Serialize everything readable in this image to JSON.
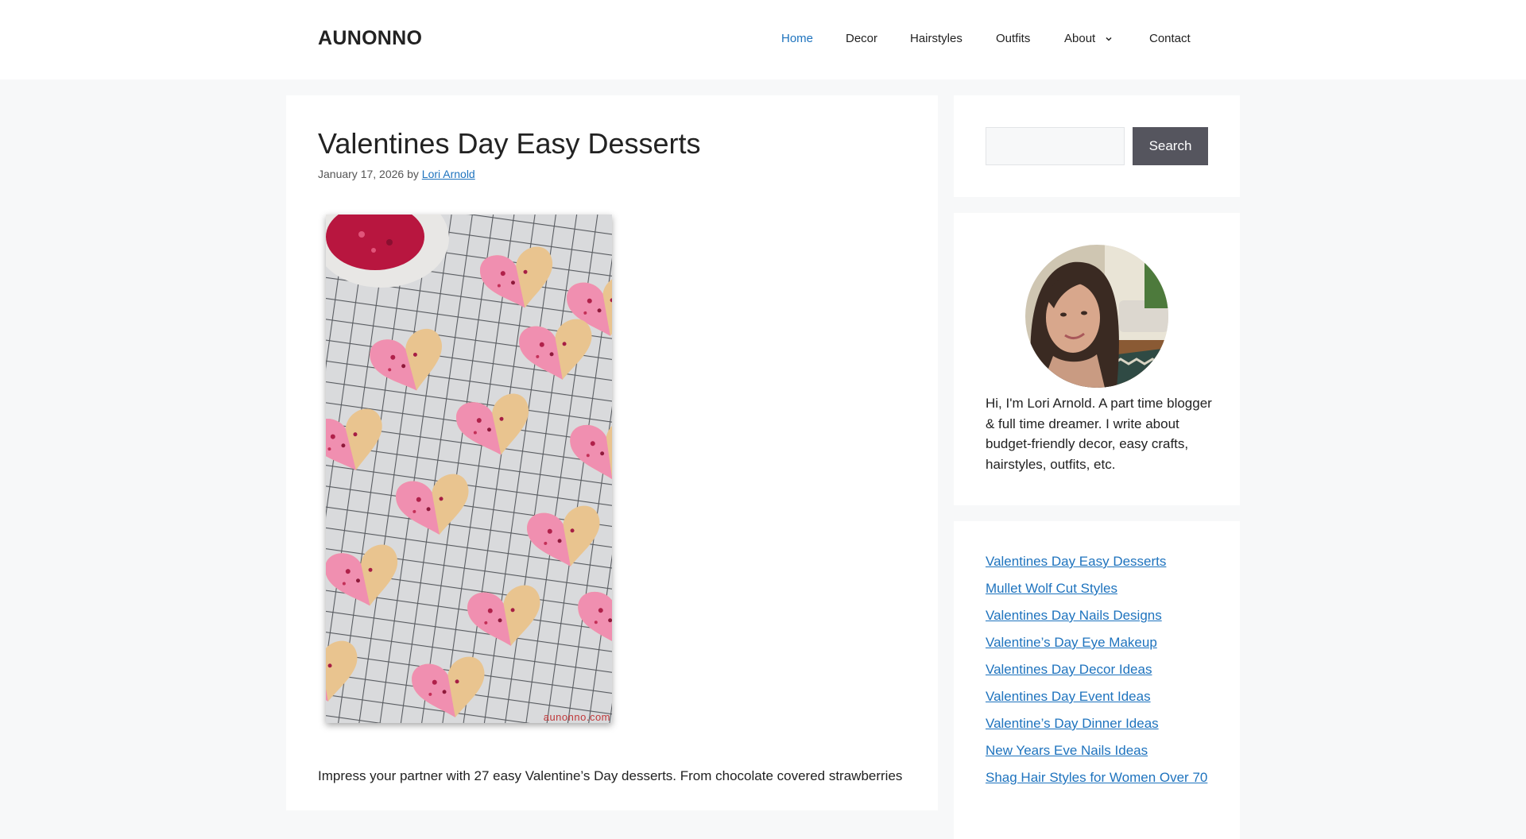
{
  "site": {
    "logo": "AUNONNO"
  },
  "nav": {
    "items": [
      {
        "label": "Home",
        "active": true
      },
      {
        "label": "Decor"
      },
      {
        "label": "Hairstyles"
      },
      {
        "label": "Outfits"
      },
      {
        "label": "About",
        "has_dropdown": true
      },
      {
        "label": "Contact"
      }
    ]
  },
  "post": {
    "title": "Valentines Day Easy Desserts",
    "date": "January 17, 2026",
    "by": "by",
    "author": "Lori Arnold",
    "image_watermark": "aunonno.com",
    "excerpt": "Impress your partner with 27 easy Valentine’s Day desserts. From chocolate covered strawberries"
  },
  "search": {
    "placeholder": "",
    "button_label": "Search"
  },
  "about": {
    "text": "Hi, I'm Lori Arnold. A part time blogger & full time dreamer. I write about budget-friendly decor, easy crafts, hairstyles, outfits, etc."
  },
  "recent_posts": [
    "Valentines Day Easy Desserts",
    "Mullet Wolf Cut Styles",
    "Valentines Day Nails Designs",
    "Valentine’s Day Eye Makeup",
    "Valentines Day Decor Ideas",
    "Valentines Day Event Ideas",
    "Valentine’s Day Dinner Ideas",
    "New Years Eve Nails Ideas",
    "Shag Hair Styles for Women Over 70"
  ],
  "colors": {
    "link": "#1e73be",
    "button": "#55555e",
    "page_bg": "#f7f8f9"
  },
  "icons": {
    "about_dropdown": "chevron-down-icon"
  }
}
